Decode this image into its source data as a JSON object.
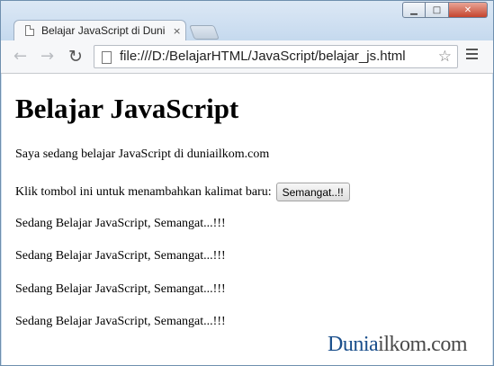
{
  "window": {
    "controls": {
      "minimize": "▁",
      "maximize": "□",
      "close": "✕"
    }
  },
  "tab": {
    "title": "Belajar JavaScript di Dunia",
    "close": "×"
  },
  "toolbar": {
    "back_icon": "←",
    "forward_icon": "→",
    "reload_icon": "↻",
    "url": "file:///D:/BelajarHTML/JavaScript/belajar_js.html",
    "star_icon": "☆"
  },
  "page": {
    "heading": "Belajar JavaScript",
    "intro": "Saya sedang belajar JavaScript di duniailkom.com",
    "klik_text": "Klik tombol ini untuk menambahkan kalimat baru:",
    "button_label": "Semangat..!!",
    "added_lines": [
      "Sedang Belajar JavaScript, Semangat...!!!",
      "Sedang Belajar JavaScript, Semangat...!!!",
      "Sedang Belajar JavaScript, Semangat...!!!",
      "Sedang Belajar JavaScript, Semangat...!!!"
    ]
  },
  "watermark": {
    "part1": "Dunia",
    "part2": "ilkom.com"
  }
}
